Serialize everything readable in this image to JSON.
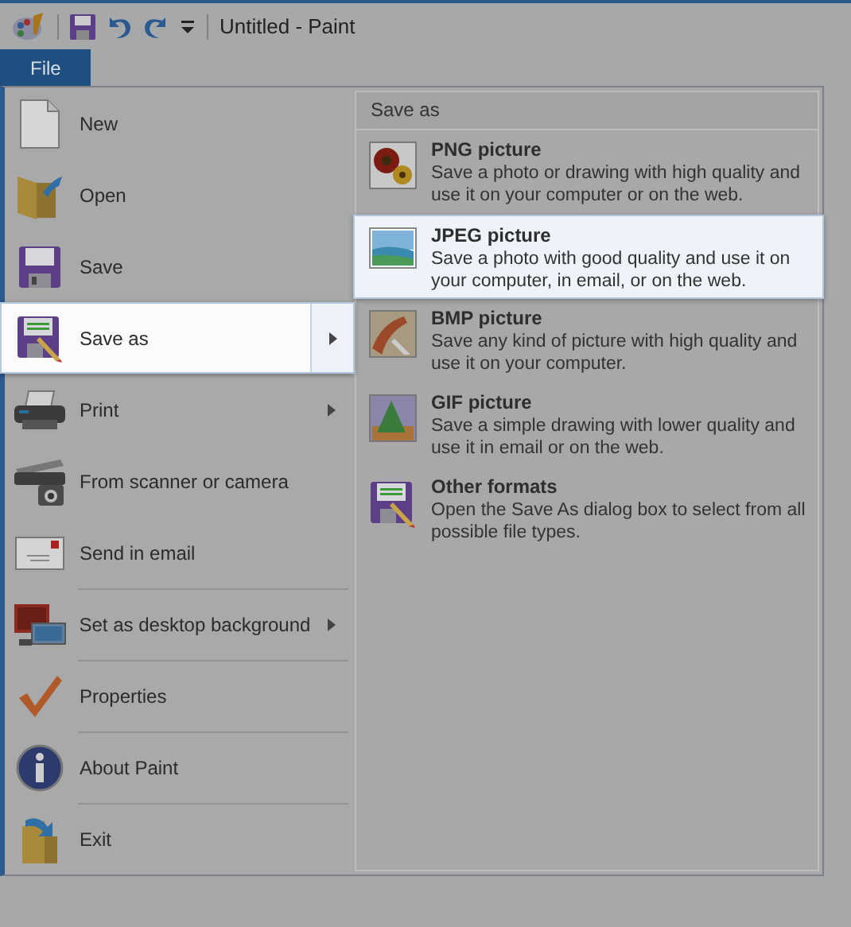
{
  "window": {
    "title": "Untitled - Paint"
  },
  "tabs": [
    {
      "label": "File",
      "selected": true
    }
  ],
  "file_menu": {
    "items": [
      {
        "label": "New",
        "has_submenu": false,
        "selected": false,
        "divider_above": false
      },
      {
        "label": "Open",
        "has_submenu": false,
        "selected": false,
        "divider_above": false
      },
      {
        "label": "Save",
        "has_submenu": false,
        "selected": false,
        "divider_above": false
      },
      {
        "label": "Save as",
        "has_submenu": true,
        "selected": true,
        "divider_above": false
      },
      {
        "label": "Print",
        "has_submenu": true,
        "selected": false,
        "divider_above": false
      },
      {
        "label": "From scanner or camera",
        "has_submenu": false,
        "selected": false,
        "divider_above": false
      },
      {
        "label": "Send in email",
        "has_submenu": false,
        "selected": false,
        "divider_above": false
      },
      {
        "label": "Set as desktop background",
        "has_submenu": true,
        "selected": false,
        "divider_above": true
      },
      {
        "label": "Properties",
        "has_submenu": false,
        "selected": false,
        "divider_above": true
      },
      {
        "label": "About Paint",
        "has_submenu": false,
        "selected": false,
        "divider_above": true
      },
      {
        "label": "Exit",
        "has_submenu": false,
        "selected": false,
        "divider_above": true
      }
    ]
  },
  "save_as_panel": {
    "title": "Save as",
    "options": [
      {
        "title": "PNG picture",
        "description": "Save a photo or drawing with high quality and use it on your computer or on the web.",
        "selected": false
      },
      {
        "title": "JPEG picture",
        "description": "Save a photo with good quality and use it on your computer, in email, or on the web.",
        "selected": true
      },
      {
        "title": "BMP picture",
        "description": "Save any kind of picture with high quality and use it on your computer.",
        "selected": false
      },
      {
        "title": "GIF picture",
        "description": "Save a simple drawing with lower quality and use it in email or on the web.",
        "selected": false
      },
      {
        "title": "Other formats",
        "description": "Open the Save As dialog box to select from all possible file types.",
        "selected": false
      }
    ]
  }
}
